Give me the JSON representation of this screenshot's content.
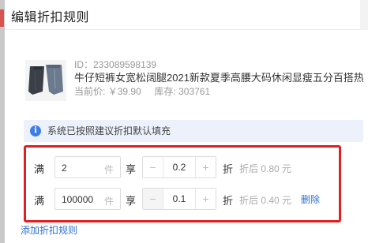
{
  "modal": {
    "title": "编辑折扣规则"
  },
  "product": {
    "id_label": "ID：233089598139",
    "title": "牛仔短裤女宽松阔腿2021新款夏季高腰大码休闲显瘦五分百搭热裤",
    "current_price_label": "当前价:",
    "current_price": "￥39.90",
    "stock_label": "库存:",
    "stock": "303761"
  },
  "info_bar": {
    "icon": "info-icon",
    "text": "系统已按照建议折扣默认填充"
  },
  "rules": {
    "man_label": "满",
    "unit": "件",
    "xiang_label": "享",
    "zhe_label": "折",
    "minus_symbol": "−",
    "plus_symbol": "+",
    "delete_label": "删除",
    "items": [
      {
        "quantity": "2",
        "discount": "0.2",
        "after_text": "折后 0.80 元"
      },
      {
        "quantity": "100000",
        "discount": "0.1",
        "after_text": "折后 0.40 元"
      }
    ]
  },
  "add_rule_label": "添加折扣规则",
  "colors": {
    "accent_blue": "#2d6fd6",
    "highlight_red": "#e02020",
    "info_bg": "#ecf1fc"
  }
}
